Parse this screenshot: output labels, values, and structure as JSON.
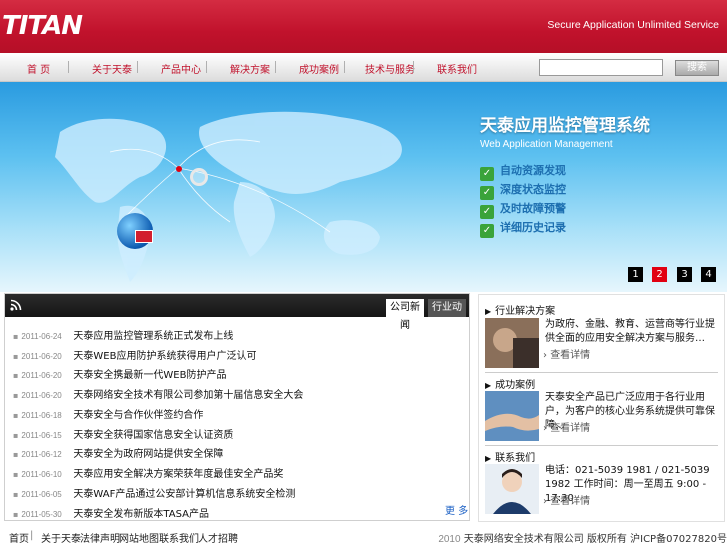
{
  "header": {
    "logo": "TITAN",
    "slogan": "Secure Application Unlimited Service"
  },
  "nav": {
    "items": [
      "首 页",
      "关于天泰",
      "产品中心",
      "解决方案",
      "成功案例",
      "技术与服务",
      "联系我们"
    ],
    "search_placeholder": "",
    "search_button": "搜索"
  },
  "banner": {
    "title": "天泰应用监控管理系统",
    "subtitle": "Web Application Management",
    "features": [
      "自动资源发现",
      "深度状态监控",
      "及时故障预警",
      "详细历史记录"
    ],
    "pages": [
      "1",
      "2",
      "3",
      "4"
    ],
    "active_page": "2"
  },
  "news": {
    "tabs": [
      "公司新闻",
      "行业动态"
    ],
    "items": [
      {
        "date": "2011-06-24",
        "title": "天泰应用监控管理系统正式发布上线"
      },
      {
        "date": "2011-06-20",
        "title": "天泰WEB应用防护系统获得用户广泛认可"
      },
      {
        "date": "2011-06-20",
        "title": "天泰安全携最新一代WEB防护产品"
      },
      {
        "date": "2011-06-20",
        "title": "天泰网络安全技术有限公司参加第十届信息安全大会"
      },
      {
        "date": "2011-06-18",
        "title": "天泰安全与合作伙伴签约合作"
      },
      {
        "date": "2011-06-15",
        "title": "天泰安全获得国家信息安全认证资质"
      },
      {
        "date": "2011-06-12",
        "title": "天泰安全为政府网站提供安全保障"
      },
      {
        "date": "2011-06-10",
        "title": "天泰应用安全解决方案荣获年度最佳安全产品奖"
      },
      {
        "date": "2011-06-05",
        "title": "天泰WAF产品通过公安部计算机信息系统安全检测"
      },
      {
        "date": "2011-05-30",
        "title": "天泰安全发布新版本TASA产品"
      }
    ],
    "more": "更 多"
  },
  "side": {
    "sections": [
      {
        "heading": "行业解决方案",
        "text": "为政府、金融、教育、运营商等行业提供全面的应用安全解决方案与服务…",
        "more": "查看详情"
      },
      {
        "heading": "成功案例",
        "text": "天泰安全产品已广泛应用于各行业用户，为客户的核心业务系统提供可靠保障…",
        "more": "查看详情"
      },
      {
        "heading": "联系我们",
        "text": "电话：021-5039 1981 / 021-5039 1982 工作时间：周一至周五 9:00 - 17:30",
        "more": "查看详情"
      }
    ]
  },
  "footer": {
    "links": [
      "首页",
      "关于天泰",
      "法律声明",
      "网站地图",
      "联系我们",
      "人才招聘"
    ],
    "year": "2010",
    "copyright": "天泰网络安全技术有限公司 版权所有",
    "icp": "沪ICP备07027820号"
  }
}
